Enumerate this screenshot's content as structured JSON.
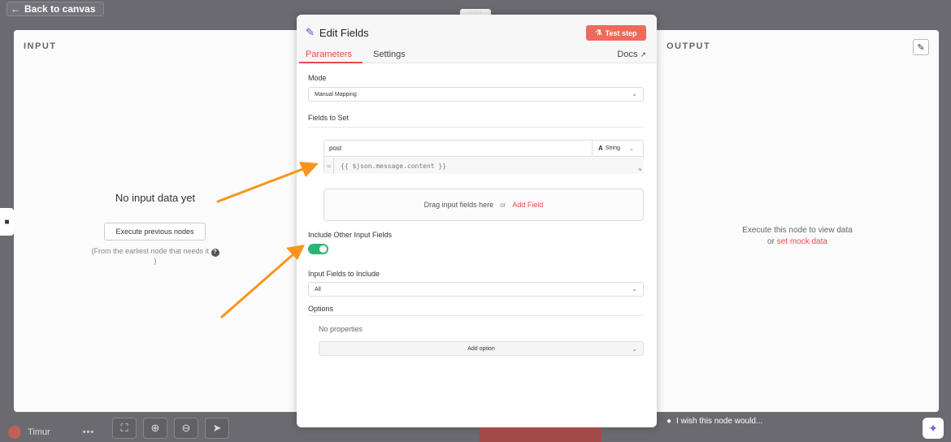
{
  "canvas": {
    "back_label": "Back to canvas",
    "user_name": "Timur",
    "user_more": "•••",
    "wish_text": "I wish this node would...",
    "zoom_buttons": [
      "fit",
      "zoom-in",
      "zoom-out",
      "pointer"
    ]
  },
  "input_panel": {
    "title": "INPUT",
    "empty_title": "No input data yet",
    "execute_label": "Execute previous nodes",
    "hint": "(From the earliest node that needs it"
  },
  "output_panel": {
    "title": "OUTPUT",
    "empty_line1": "Execute this node to view data",
    "empty_or": "or",
    "mock_link": "set mock data"
  },
  "dialog": {
    "title": "Edit Fields",
    "test_step_label": "Test step",
    "tabs": [
      {
        "label": "Parameters",
        "active": true
      },
      {
        "label": "Settings",
        "active": false
      }
    ],
    "docs_label": "Docs",
    "mode_label": "Mode",
    "mode_value": "Manual Mapping",
    "fields_to_set_label": "Fields to Set",
    "field": {
      "name": "post",
      "type": "String",
      "eq": "=",
      "value": "{{ $json.message.content }}"
    },
    "drop_text": "Drag input fields here",
    "drop_or": "or",
    "add_field_label": "Add Field",
    "include_other_label": "Include Other Input Fields",
    "include_other_enabled": true,
    "input_fields_label": "Input Fields to Include",
    "input_fields_value": "All",
    "options_label": "Options",
    "no_properties": "No properties",
    "add_option_label": "Add option"
  },
  "colors": {
    "accent": "#ea4b4b",
    "test_button": "#ee6b5b",
    "toggle_on": "#2bb673",
    "arrow": "#f7941d",
    "pencil": "#5a4be0"
  }
}
